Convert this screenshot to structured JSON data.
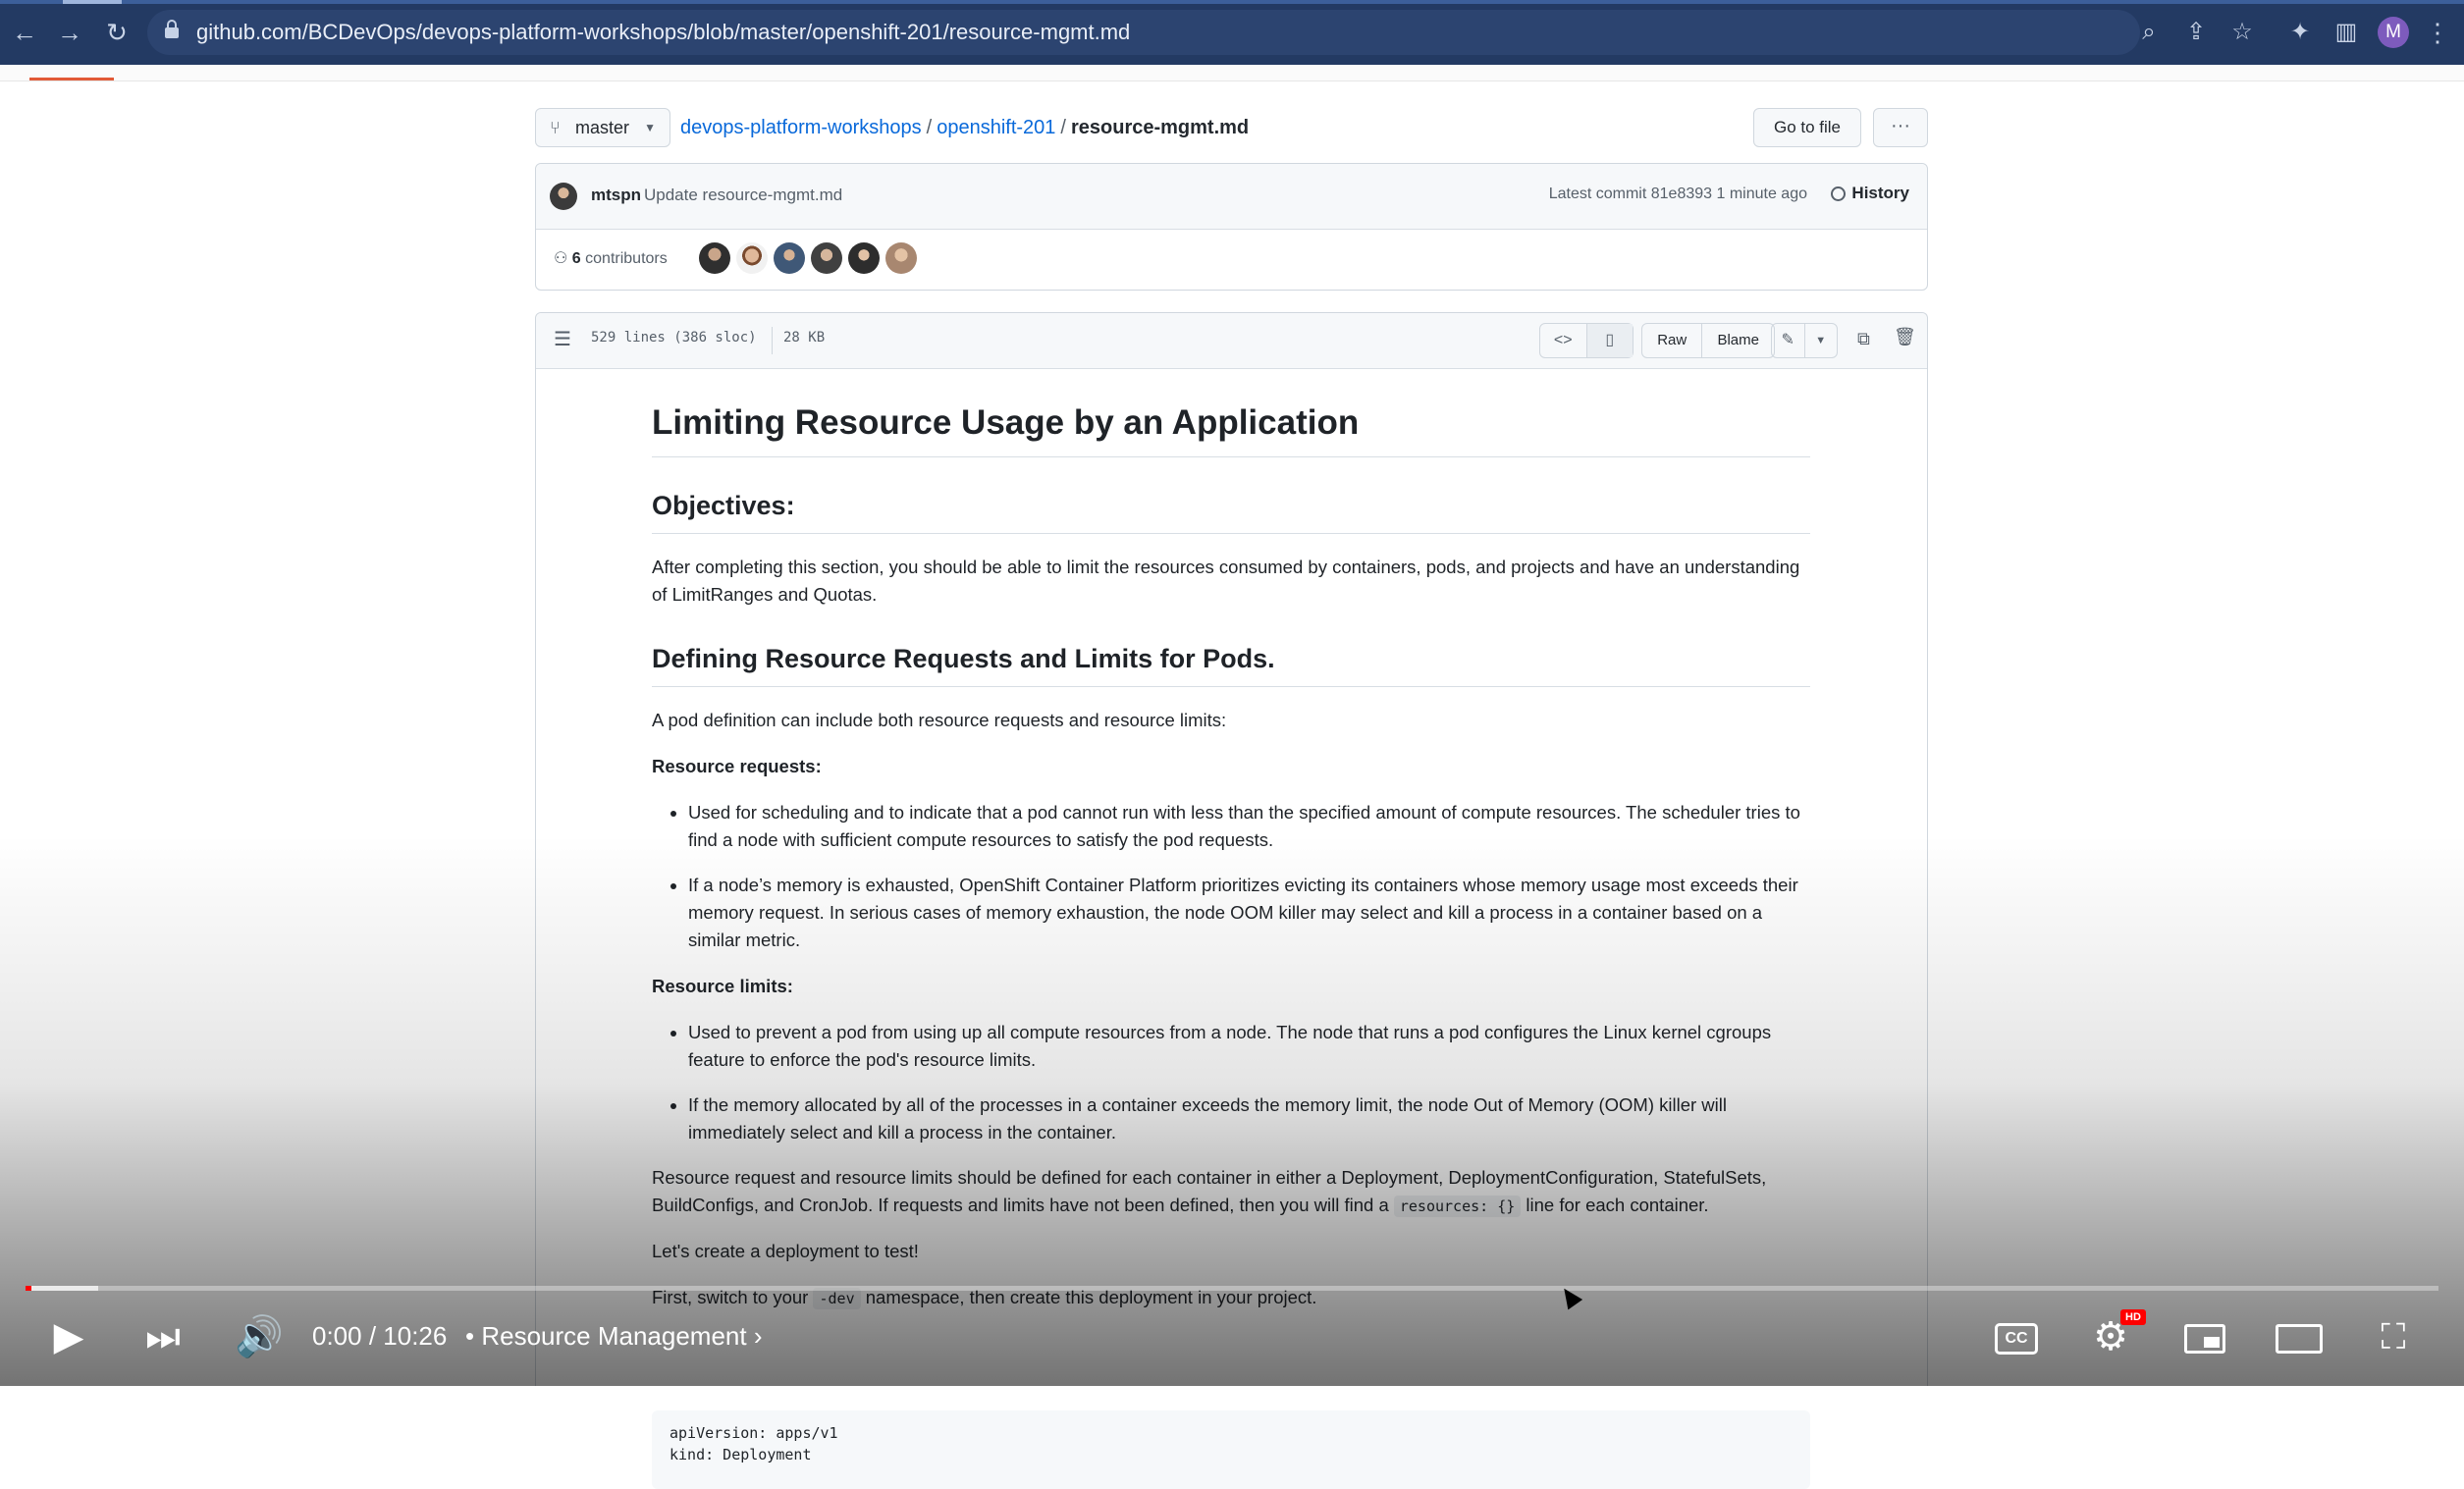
{
  "browser": {
    "url": "github.com/BCDevOps/devops-platform-workshops/blob/master/openshift-201/resource-mgmt.md",
    "profile_initial": "M",
    "nav": {
      "back": "←",
      "forward": "→",
      "reload": "↻"
    },
    "toolbar_icons": {
      "zoom": "⌕",
      "share": "⇪",
      "bookmark": "☆",
      "extensions": "✦",
      "sidepanel": "▥",
      "menu": "⋮"
    }
  },
  "repo": {
    "branch": "master",
    "breadcrumb": {
      "repo": "devops-platform-workshops",
      "folder": "openshift-201",
      "file": "resource-mgmt.md",
      "sep": "/"
    },
    "go_to_file": "Go to file",
    "more": "···"
  },
  "commit": {
    "author": "mtspn",
    "message": "Update resource-mgmt.md",
    "meta": "Latest commit 81e8393 1 minute ago",
    "history": "History",
    "contributors_count": "6",
    "contributors_label": "contributors"
  },
  "file": {
    "lines": "529 lines (386 sloc)",
    "size": "28 KB",
    "icons": {
      "toc": "☰",
      "code": "<>",
      "preview": "▯",
      "edit": "✎",
      "caret": "▼",
      "copy": "⧉",
      "trash": "🗑"
    },
    "raw": "Raw",
    "blame": "Blame"
  },
  "content": {
    "h1": "Limiting Resource Usage by an Application",
    "objectives_heading": "Objectives:",
    "objectives_text": "After completing this section, you should be able to limit the resources consumed by containers, pods, and projects and have an understanding of LimitRanges and Quotas.",
    "defining_heading": "Defining Resource Requests and Limits for Pods.",
    "defining_text": "A pod definition can include both resource requests and resource limits:",
    "requests_label": "Resource requests:",
    "requests_items": [
      "Used for scheduling and to indicate that a pod cannot run with less than the specified amount of compute resources. The scheduler tries to find a node with sufficient compute resources to satisfy the pod requests.",
      "If a node’s memory is exhausted, OpenShift Container Platform prioritizes evicting its containers whose memory usage most exceeds their memory request. In serious cases of memory exhaustion, the node OOM killer may select and kill a process in a container based on a similar metric."
    ],
    "limits_label": "Resource limits:",
    "limits_items": [
      "Used to prevent a pod from using up all compute resources from a node. The node that runs a pod configures the Linux kernel cgroups feature to enforce the pod's resource limits.",
      "If the memory allocated by all of the processes in a container exceeds the memory limit, the node Out of Memory (OOM) killer will immediately select and kill a process in the container."
    ],
    "para_defined_a": "Resource request and resource limits should be defined for each container in either a Deployment, DeploymentConfiguration, StatefulSets, BuildConfigs, and CronJob. If requests and limits have not been defined, then you will find a",
    "para_defined_code": "resources: {}",
    "para_defined_b": "line for each container.",
    "lets_create": "Let's create a deployment to test!",
    "first_switch_a": "First, switch to your",
    "first_switch_code": "-dev",
    "first_switch_b": "namespace, then create this deployment in your project.",
    "code_line_1": "apiVersion: apps/v1",
    "code_line_2": "kind: Deployment"
  },
  "player": {
    "time": "0:00 / 10:26",
    "separator": "•",
    "chapter": "Resource Management",
    "chapter_arrow": "›",
    "progress_played": 0.0,
    "progress_buffered": 0.03,
    "icons": {
      "play": "▶",
      "next": "⏭",
      "volume": "🔊",
      "cc": "CC",
      "settings": "⚙",
      "fullscreen": "⛶"
    },
    "hd_badge": "HD"
  },
  "colors": {
    "chrome": "#233a63",
    "link": "#0969da",
    "progress": "#ff0000",
    "hd": "#ff0000"
  }
}
